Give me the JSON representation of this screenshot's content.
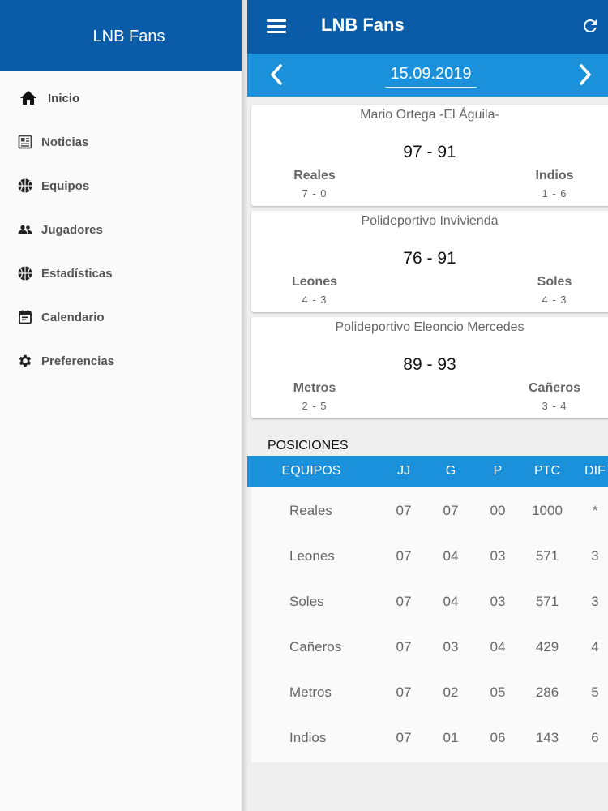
{
  "drawer": {
    "title": "LNB Fans",
    "items": [
      {
        "label": "Inicio",
        "icon": "home-icon"
      },
      {
        "label": "Noticias",
        "icon": "newspaper-icon"
      },
      {
        "label": "Equipos",
        "icon": "basketball-icon"
      },
      {
        "label": "Jugadores",
        "icon": "people-icon"
      },
      {
        "label": "Estadísticas",
        "icon": "basketball-icon"
      },
      {
        "label": "Calendario",
        "icon": "calendar-icon"
      },
      {
        "label": "Preferencias",
        "icon": "gear-icon"
      }
    ]
  },
  "appbar": {
    "title": "LNB Fans",
    "menu_icon": "hamburger-menu-icon",
    "refresh_icon": "refresh-icon"
  },
  "datebar": {
    "date": "15.09.2019",
    "prev_icon": "chevron-left-icon",
    "next_icon": "chevron-right-icon"
  },
  "games": [
    {
      "venue": "Mario Ortega -El Águila-",
      "score": "97 - 91",
      "home": {
        "name": "Reales",
        "record": "7 - 0"
      },
      "away": {
        "name": "Indios",
        "record": "1 - 6"
      }
    },
    {
      "venue": "Polideportivo Invivienda",
      "score": "76 - 91",
      "home": {
        "name": "Leones",
        "record": "4 - 3"
      },
      "away": {
        "name": "Soles",
        "record": "4 - 3"
      }
    },
    {
      "venue": "Polideportivo Eleoncio Mercedes",
      "score": "89 - 93",
      "home": {
        "name": "Metros",
        "record": "2 - 5"
      },
      "away": {
        "name": "Cañeros",
        "record": "3 - 4"
      }
    }
  ],
  "standings": {
    "title": "POSICIONES",
    "columns": [
      "EQUIPOS",
      "JJ",
      "G",
      "P",
      "PTC",
      "DIF"
    ],
    "rows": [
      [
        "Reales",
        "07",
        "07",
        "00",
        "1000",
        "*"
      ],
      [
        "Leones",
        "07",
        "04",
        "03",
        "571",
        "3"
      ],
      [
        "Soles",
        "07",
        "04",
        "03",
        "571",
        "3"
      ],
      [
        "Cañeros",
        "07",
        "03",
        "04",
        "429",
        "4"
      ],
      [
        "Metros",
        "07",
        "02",
        "05",
        "286",
        "5"
      ],
      [
        "Indios",
        "07",
        "01",
        "06",
        "143",
        "6"
      ]
    ]
  },
  "colors": {
    "appbar": "#0a5ca8",
    "accent": "#1a91da"
  }
}
